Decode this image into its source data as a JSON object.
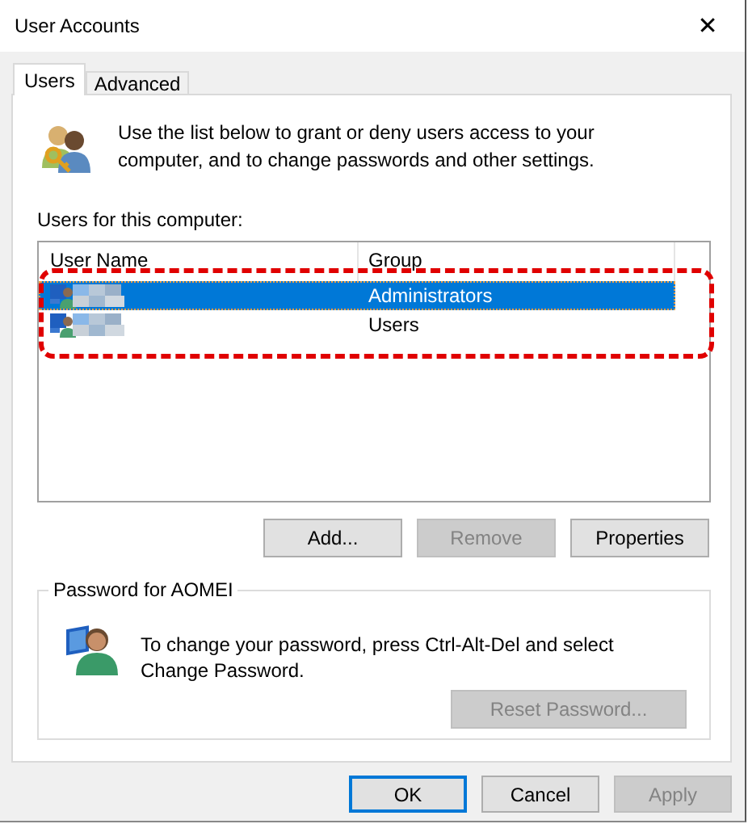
{
  "window": {
    "title": "User Accounts",
    "close": "✕"
  },
  "tabs": [
    {
      "label": "Users",
      "selected": true
    },
    {
      "label": "Advanced",
      "selected": false
    }
  ],
  "intro": "Use the list below to grant or deny users access to your computer, and to change passwords and other settings.",
  "users_label": "Users for this computer:",
  "table": {
    "columns": [
      "User Name",
      "Group"
    ],
    "rows": [
      {
        "group": "Administrators",
        "selected": true
      },
      {
        "group": "Users",
        "selected": false
      }
    ]
  },
  "list_buttons": [
    {
      "label": "Add...",
      "disabled": false
    },
    {
      "label": "Remove",
      "disabled": true
    },
    {
      "label": "Properties",
      "disabled": false
    }
  ],
  "password_group": {
    "title": "Password for AOMEI",
    "text": "To change your password, press Ctrl-Alt-Del and select Change Password.",
    "button": {
      "label": "Reset Password...",
      "disabled": true
    }
  },
  "dialog_buttons": [
    {
      "label": "OK",
      "disabled": false,
      "default": true
    },
    {
      "label": "Cancel",
      "disabled": false,
      "default": false
    },
    {
      "label": "Apply",
      "disabled": true,
      "default": false
    }
  ]
}
